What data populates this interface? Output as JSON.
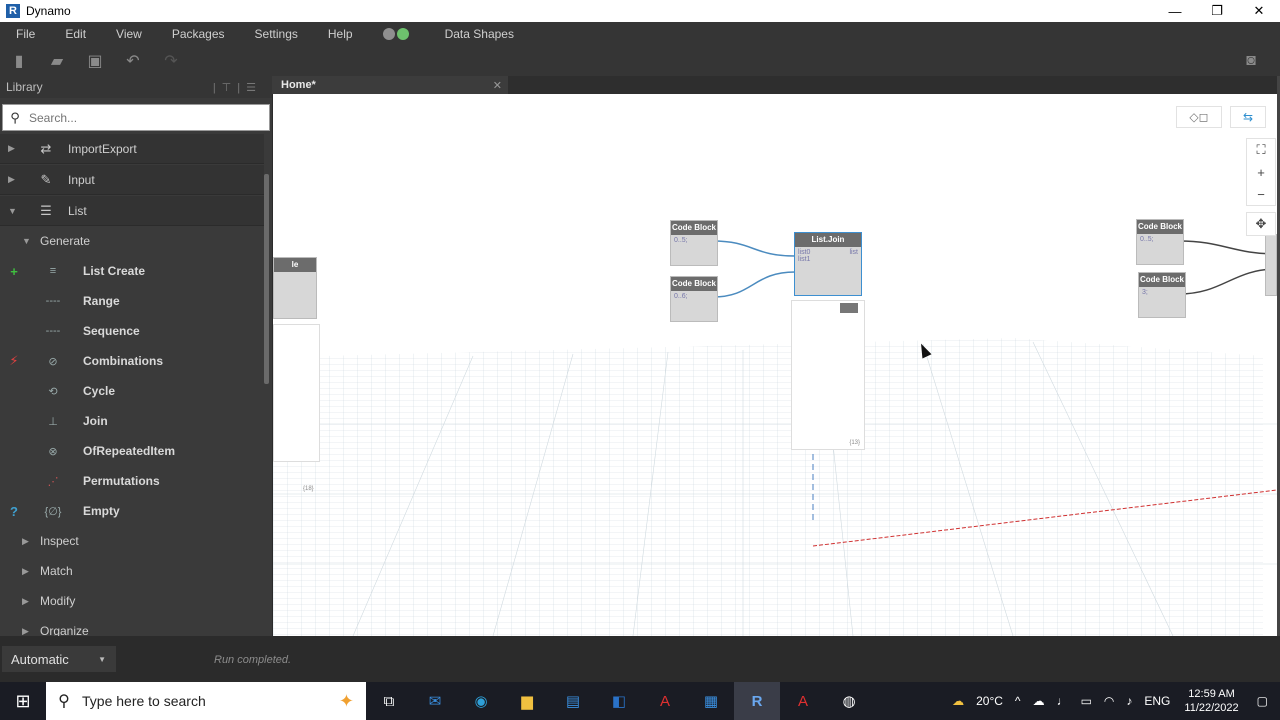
{
  "window": {
    "title": "Dynamo",
    "minimize": "—",
    "restore": "❐",
    "close": "✕"
  },
  "menu": {
    "items": [
      "File",
      "Edit",
      "View",
      "Packages",
      "Settings",
      "Help"
    ],
    "extra": "Data Shapes"
  },
  "library": {
    "header": "Library",
    "search_placeholder": "Search...",
    "categories": [
      {
        "label": "ImportExport",
        "icon": "⇄"
      },
      {
        "label": "Input",
        "icon": "✎"
      },
      {
        "label": "List",
        "icon": "☰"
      }
    ],
    "subgroup": "Generate",
    "items": [
      {
        "label": "List Create",
        "tag": "+",
        "tag_color": "#3fbf3f"
      },
      {
        "label": "Range",
        "tag": "",
        "tag_color": ""
      },
      {
        "label": "Sequence",
        "tag": "",
        "tag_color": ""
      },
      {
        "label": "Combinations",
        "tag": "⚡",
        "tag_color": "#e04040"
      },
      {
        "label": "Cycle",
        "tag": "",
        "tag_color": ""
      },
      {
        "label": "Join",
        "tag": "",
        "tag_color": ""
      },
      {
        "label": "OfRepeatedItem",
        "tag": "",
        "tag_color": ""
      },
      {
        "label": "Permutations",
        "tag": "",
        "tag_color": ""
      },
      {
        "label": "Empty",
        "tag": "?",
        "tag_color": "#3fa0d0"
      }
    ],
    "collapsed_groups": [
      "Inspect",
      "Match",
      "Modify",
      "Organize"
    ]
  },
  "tab": {
    "label": "Home*"
  },
  "nodes": {
    "code_block_1": {
      "title": "Code Block",
      "code": "0..5;"
    },
    "code_block_2": {
      "title": "Code Block",
      "code": "0..6;"
    },
    "list_join": {
      "title": "List.Join",
      "in1": "list0",
      "in2": "list1",
      "out": "list"
    },
    "code_block_3": {
      "title": "Code Block",
      "code": "0..5;"
    },
    "code_block_4": {
      "title": "Code Block",
      "code": "3;"
    },
    "preview_count": "{13}",
    "left_preview_count": "{18}"
  },
  "status": {
    "run_mode": "Automatic",
    "message": "Run completed."
  },
  "taskbar": {
    "search_placeholder": "Type here to search",
    "weather": "20°C",
    "language": "ENG",
    "time": "12:59 AM",
    "date": "11/22/2022"
  }
}
